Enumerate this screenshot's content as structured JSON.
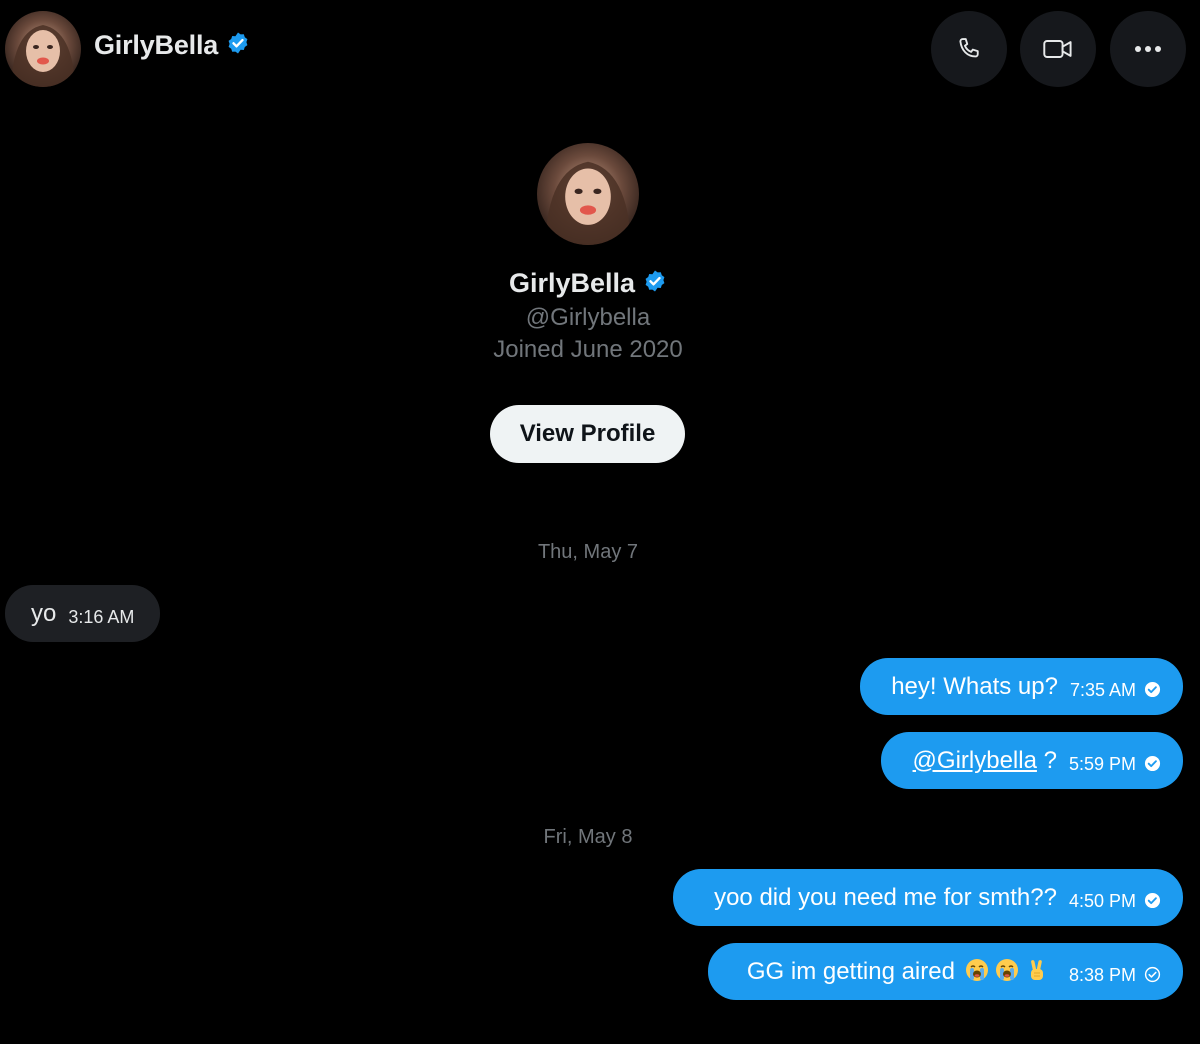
{
  "header": {
    "name": "GirlyBella",
    "verified_icon": "verified-badge-icon",
    "actions": [
      "phone-icon",
      "video-icon",
      "more-icon"
    ]
  },
  "profile": {
    "name": "GirlyBella",
    "handle": "@Girlybella",
    "joined": "Joined June 2020",
    "view_profile_label": "View Profile"
  },
  "dates": {
    "first": "Thu, May 7",
    "second": "Fri, May 8"
  },
  "messages": [
    {
      "direction": "in",
      "text": "yo",
      "time": "3:16 AM"
    },
    {
      "direction": "out",
      "text": "hey! Whats up?",
      "time": "7:35 AM",
      "status": "read"
    },
    {
      "direction": "out",
      "mention": "@Girlybella",
      "text": " ?",
      "time": "5:59 PM",
      "status": "read"
    },
    {
      "direction": "out",
      "text": "yoo did you need me for smth??",
      "time": "4:50 PM",
      "status": "read"
    },
    {
      "direction": "out",
      "text": "GG im getting aired",
      "emojis": [
        "loudly-crying-face",
        "loudly-crying-face",
        "victory-hand"
      ],
      "time": "8:38 PM",
      "status": "sent"
    }
  ],
  "colors": {
    "background": "#000000",
    "outgoing_bubble": "#1d9bf0",
    "incoming_bubble": "#1e2024",
    "verified": "#1d9bf0",
    "muted_text": "#71767b"
  }
}
